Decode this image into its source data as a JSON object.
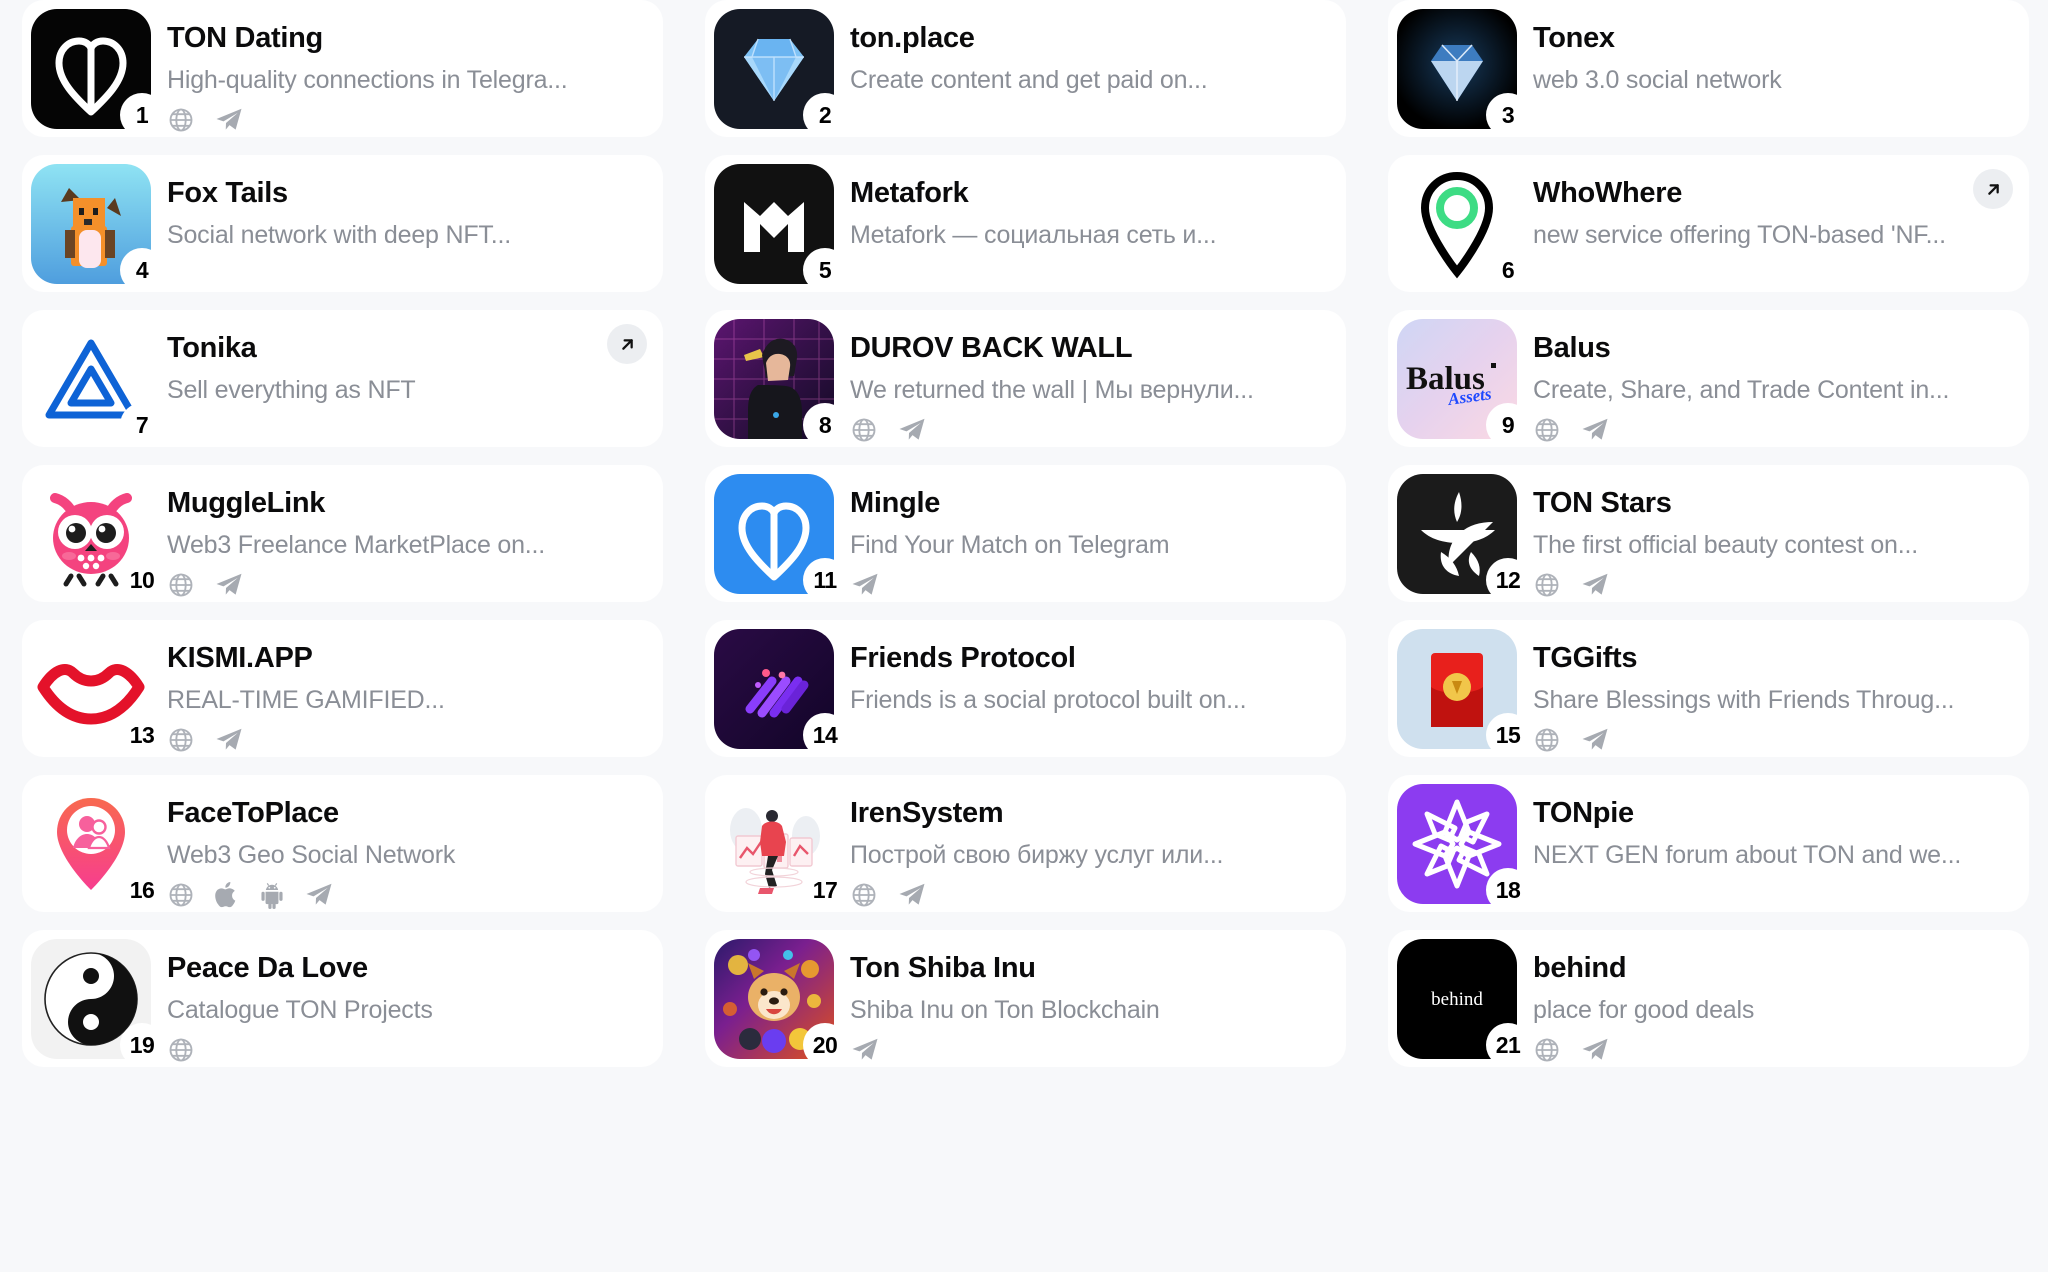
{
  "page": {
    "background": "#f7f8fa",
    "card_background": "#ffffff",
    "title_color": "#0b0b0c",
    "subtitle_color": "#8a8e96",
    "columns": 3
  },
  "link_icon_names": {
    "web": "globe-icon",
    "telegram": "telegram-icon",
    "apple": "apple-icon",
    "android": "android-icon",
    "external": "external-link-icon"
  },
  "cards": [
    {
      "rank": "1",
      "title": "TON Dating",
      "subtitle": "High-quality connections in Telegra...",
      "links": [
        "web",
        "telegram"
      ],
      "external": false,
      "icon": "ton-dating-heart-icon",
      "icon_bg": "#050505"
    },
    {
      "rank": "2",
      "title": "ton.place",
      "subtitle": "Create content and get paid on...",
      "links": [],
      "external": false,
      "icon": "ton-place-diamond-icon",
      "icon_bg": "#151a25"
    },
    {
      "rank": "3",
      "title": "Tonex",
      "subtitle": "web 3.0 social network",
      "links": [],
      "external": false,
      "icon": "tonex-diamond-icon",
      "icon_bg": "#000000"
    },
    {
      "rank": "4",
      "title": "Fox Tails",
      "subtitle": "Social network with deep NFT...",
      "links": [],
      "external": false,
      "icon": "fox-tails-pixel-fox-icon",
      "icon_bg": "#7fd7ef"
    },
    {
      "rank": "5",
      "title": "Metafork",
      "subtitle": "Metafork — социальная сеть и...",
      "links": [],
      "external": false,
      "icon": "metafork-m-icon",
      "icon_bg": "#111111"
    },
    {
      "rank": "6",
      "title": "WhoWhere",
      "subtitle": "new service offering TON-based 'NF...",
      "links": [],
      "external": true,
      "icon": "whowhere-map-pin-icon",
      "icon_bg": "transparent"
    },
    {
      "rank": "7",
      "title": "Tonika",
      "subtitle": "Sell everything as NFT",
      "links": [],
      "external": true,
      "icon": "tonika-triangle-icon",
      "icon_bg": "transparent"
    },
    {
      "rank": "8",
      "title": "DUROV BACK WALL",
      "subtitle": "We returned the wall | Мы вернули...",
      "links": [
        "web",
        "telegram"
      ],
      "external": false,
      "icon": "durov-back-wall-portrait-icon",
      "icon_bg": "#2a1033"
    },
    {
      "rank": "9",
      "title": "Balus",
      "subtitle": "Create, Share, and Trade Content in...",
      "links": [
        "web",
        "telegram"
      ],
      "external": false,
      "icon": "balus-wordmark-icon",
      "icon_bg": "#e8d8ef"
    },
    {
      "rank": "10",
      "title": "MuggleLink",
      "subtitle": "Web3 Freelance MarketPlace on...",
      "links": [
        "web",
        "telegram"
      ],
      "external": false,
      "icon": "mugglelink-owl-icon",
      "icon_bg": "transparent"
    },
    {
      "rank": "11",
      "title": "Mingle",
      "subtitle": "Find Your Match on Telegram",
      "links": [
        "telegram"
      ],
      "external": false,
      "icon": "mingle-heart-icon",
      "icon_bg": "#2d8cf0"
    },
    {
      "rank": "12",
      "title": "TON Stars",
      "subtitle": "The first official beauty contest on...",
      "links": [
        "web",
        "telegram"
      ],
      "external": false,
      "icon": "ton-stars-star-icon",
      "icon_bg": "#1b1b1b"
    },
    {
      "rank": "13",
      "title": "KISMI.APP",
      "subtitle": "REAL-TIME GAMIFIED...",
      "links": [
        "web",
        "telegram"
      ],
      "external": false,
      "icon": "kismi-lips-icon",
      "icon_bg": "transparent"
    },
    {
      "rank": "14",
      "title": "Friends Protocol",
      "subtitle": "Friends is a social protocol built on...",
      "links": [],
      "external": false,
      "icon": "friends-protocol-streaks-icon",
      "icon_bg": "#1d0830"
    },
    {
      "rank": "15",
      "title": "TGGifts",
      "subtitle": "Share Blessings with Friends Throug...",
      "links": [
        "web",
        "telegram"
      ],
      "external": false,
      "icon": "tggifts-red-envelope-icon",
      "icon_bg": "#cfe0ee"
    },
    {
      "rank": "16",
      "title": "FaceToPlace",
      "subtitle": "Web3 Geo Social Network",
      "links": [
        "web",
        "apple",
        "android",
        "telegram"
      ],
      "external": false,
      "icon": "facetoplace-pin-avatar-icon",
      "icon_bg": "transparent"
    },
    {
      "rank": "17",
      "title": "IrenSystem",
      "subtitle": "Построй свою биржу услуг или...",
      "links": [
        "web",
        "telegram"
      ],
      "external": false,
      "icon": "irensystem-illustration-icon",
      "icon_bg": "#ffffff"
    },
    {
      "rank": "18",
      "title": "TONpie",
      "subtitle": "NEXT GEN forum about TON and we...",
      "links": [],
      "external": false,
      "icon": "tonpie-pinwheel-icon",
      "icon_bg": "#8c3cf0"
    },
    {
      "rank": "19",
      "title": "Peace Da Love",
      "subtitle": "Catalogue TON Projects",
      "links": [
        "web"
      ],
      "external": false,
      "icon": "peace-da-love-yinyang-icon",
      "icon_bg": "#f2f2f2"
    },
    {
      "rank": "20",
      "title": "Ton Shiba Inu",
      "subtitle": "Shiba Inu on Ton Blockchain",
      "links": [
        "telegram"
      ],
      "external": false,
      "icon": "ton-shiba-inu-dog-icon",
      "icon_bg": "#d63a2a"
    },
    {
      "rank": "21",
      "title": "behind",
      "subtitle": "place for good deals",
      "links": [
        "web",
        "telegram"
      ],
      "external": false,
      "icon": "behind-wordmark-icon",
      "icon_bg": "#000000",
      "icon_text": "behind"
    }
  ]
}
